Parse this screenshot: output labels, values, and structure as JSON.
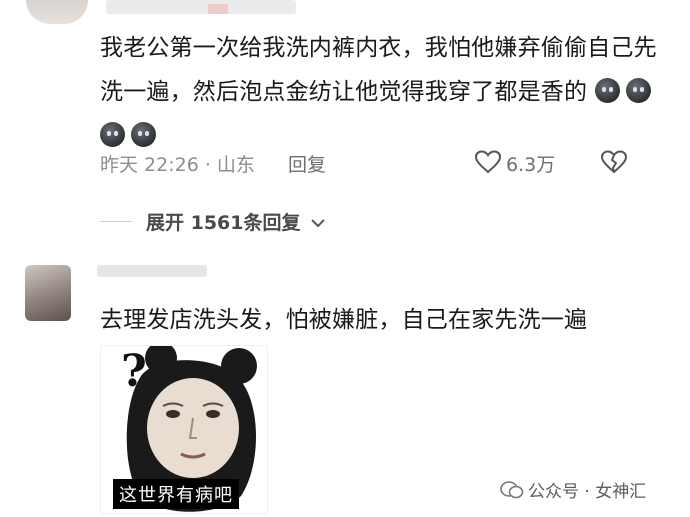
{
  "comment1": {
    "text": "我老公第一次给我洗内裤内衣，我怕他嫌弃偷偷自己先洗一遍，然后泡点金纺让他觉得我穿了都是香的",
    "emoji_count": 4,
    "time": "昨天 22:26 · 山东",
    "reply_label": "回复",
    "likes": "6.3万"
  },
  "expand_label": "展开 1561条回复",
  "comment2": {
    "text": "去理发店洗头发，怕被嫌脏，自己在家先洗一遍",
    "meme_caption": "这世界有病吧",
    "meme_symbol": "?"
  },
  "watermark": "公众号 · 女神汇",
  "colors": {
    "text": "#1a1a1a",
    "meta": "#8d8d8d",
    "background": "#ffffff"
  }
}
